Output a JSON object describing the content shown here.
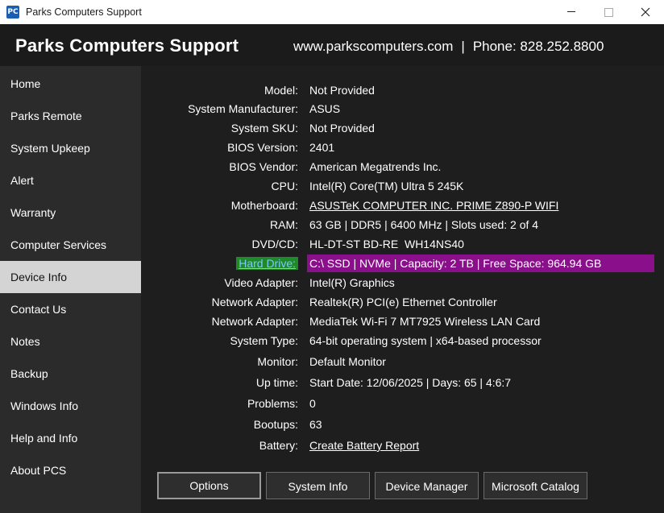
{
  "window": {
    "title": "Parks Computers Support",
    "icon_text": "PC",
    "controls": [
      "minimize",
      "maximize",
      "close"
    ]
  },
  "header": {
    "brand": "Parks Computers Support",
    "website": "www.parkscomputers.com",
    "separator": "|",
    "phone": "Phone: 828.252.8800"
  },
  "sidebar": {
    "active": "Device Info",
    "items": [
      {
        "label": "Home"
      },
      {
        "label": "Parks Remote"
      },
      {
        "label": "System Upkeep"
      },
      {
        "label": "Alert"
      },
      {
        "label": "Warranty"
      },
      {
        "label": "Computer Services"
      },
      {
        "label": "Device Info"
      },
      {
        "label": "Contact Us"
      },
      {
        "label": "Notes"
      },
      {
        "label": "Backup"
      },
      {
        "label": "Windows Info"
      },
      {
        "label": "Help and Info"
      },
      {
        "label": "About PCS"
      }
    ]
  },
  "device_info": {
    "rows": [
      {
        "label": "Model:",
        "value": "Not Provided"
      },
      {
        "label": "System Manufacturer:",
        "value": "ASUS"
      },
      {
        "label": "System SKU:",
        "value": "Not Provided"
      },
      {
        "label": "BIOS Version:",
        "value": "2401"
      },
      {
        "label": "BIOS Vendor:",
        "value": "American Megatrends Inc."
      },
      {
        "label": "CPU:",
        "value": "Intel(R) Core(TM) Ultra 5 245K"
      },
      {
        "label": "Motherboard:",
        "value": "ASUSTeK COMPUTER INC. PRIME Z890-P WIFI"
      },
      {
        "label": "RAM:",
        "value": "63 GB | DDR5 | 6400 MHz | Slots used: 2 of 4"
      },
      {
        "label": "DVD/CD:",
        "value": "HL-DT-ST BD-RE  WH14NS40"
      },
      {
        "label": "Hard Drive:",
        "value": "C:\\ SSD | NVMe | Capacity: 2 TB | Free Space: 964.94 GB"
      },
      {
        "label": "Video Adapter:",
        "value": "Intel(R) Graphics"
      },
      {
        "label": "Network Adapter:",
        "value": "Realtek(R) PCI(e) Ethernet Controller"
      },
      {
        "label": "Network Adapter:",
        "value": "MediaTek Wi-Fi 7 MT7925 Wireless LAN Card"
      },
      {
        "label": "System Type:",
        "value": "64-bit operating system | x64-based processor"
      },
      {
        "label": "Monitor:",
        "value": "Default Monitor"
      },
      {
        "label": "Up time:",
        "value": "Start Date: 12/06/2025 | Days: 65 | 4:6:7"
      },
      {
        "label": "Problems:",
        "value": "0"
      },
      {
        "label": "Bootups:",
        "value": "63"
      },
      {
        "label": "Battery:",
        "value": "Create Battery Report"
      }
    ]
  },
  "buttons": [
    {
      "label": "Options"
    },
    {
      "label": "System Info"
    },
    {
      "label": "Device Manager"
    },
    {
      "label": "Microsoft Catalog"
    }
  ],
  "colors": {
    "highlight_label_bg": "#1e8a2a",
    "highlight_value_bg": "#8a0f8a",
    "active_nav_bg": "#d4d4d4"
  }
}
